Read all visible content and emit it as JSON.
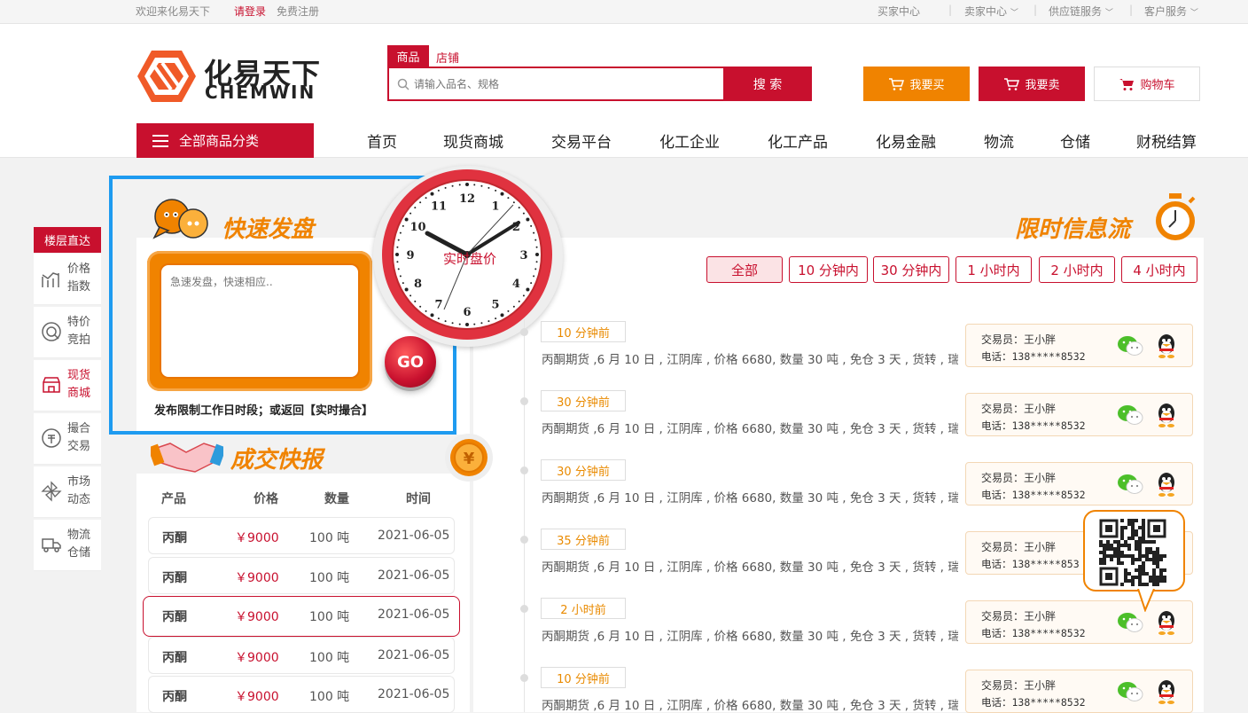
{
  "topbar": {
    "welcome": "欢迎来化易天下",
    "login": "请登录",
    "register": "免费注册",
    "links": [
      "买家中心",
      "卖家中心",
      "供应链服务",
      "客户服务"
    ]
  },
  "brand": {
    "name_cn": "化易天下",
    "name_en": "CHEMWIN"
  },
  "search": {
    "tabs": [
      "商品",
      "店铺"
    ],
    "placeholder": "请输入品名、规格",
    "button": "搜 索"
  },
  "header_buttons": {
    "buy": "我要买",
    "sell": "我要卖",
    "cart": "购物车"
  },
  "nav": {
    "all_categories": "全部商品分类",
    "items": [
      "首页",
      "现货商城",
      "交易平台",
      "化工企业",
      "化工产品",
      "化易金融",
      "物流",
      "仓储",
      "财税结算"
    ]
  },
  "sidebar": {
    "title": "楼层直达",
    "items": [
      "价格指数",
      "特价竞拍",
      "现货商城",
      "撮合交易",
      "市场动态",
      "物流仓储"
    ]
  },
  "quick_post": {
    "title": "快速发盘",
    "placeholder": "急速发盘，快速相应..",
    "go": "GO",
    "note": "发布限制工作日时段；或返回【实时撮合】"
  },
  "clock": {
    "label": "实时盘价",
    "numbers": [
      "12",
      "1",
      "2",
      "3",
      "4",
      "5",
      "6",
      "7",
      "8",
      "9",
      "10",
      "11"
    ]
  },
  "deals": {
    "title": "成交快报",
    "headers": [
      "产品",
      "价格",
      "数量",
      "时间"
    ],
    "rows": [
      [
        "丙酮",
        "￥9000",
        "100 吨",
        "2021-06-05"
      ],
      [
        "丙酮",
        "￥9000",
        "100 吨",
        "2021-06-05"
      ],
      [
        "丙酮",
        "￥9000",
        "100 吨",
        "2021-06-05"
      ],
      [
        "丙酮",
        "￥9000",
        "100 吨",
        "2021-06-05"
      ],
      [
        "丙酮",
        "￥9000",
        "100 吨",
        "2021-06-05"
      ]
    ]
  },
  "info_flow": {
    "title": "限时信息流",
    "filters": [
      "全部",
      "10 分钟内",
      "30 分钟内",
      "1 小时内",
      "2 小时内",
      "4 小时内"
    ],
    "items": [
      {
        "time": "10 分钟前",
        "text": "丙酮期货 ,6 月 10 日 , 江阴库 , 价格 6680, 数量 30 吨 , 免仓 3 天 , 货转 , 瑞桥",
        "trader": "交易员：王小胖",
        "phone": "电话：138*****8532"
      },
      {
        "time": "30 分钟前",
        "text": "丙酮期货 ,6 月 10 日 , 江阴库 , 价格 6680, 数量 30 吨 , 免仓 3 天 , 货转 , 瑞桥",
        "trader": "交易员：王小胖",
        "phone": "电话：138*****8532"
      },
      {
        "time": "30 分钟前",
        "text": "丙酮期货 ,6 月 10 日 , 江阴库 , 价格 6680, 数量 30 吨 , 免仓 3 天 , 货转 , 瑞桥",
        "trader": "交易员：王小胖",
        "phone": "电话：138*****8532"
      },
      {
        "time": "35 分钟前",
        "text": "丙酮期货 ,6 月 10 日 , 江阴库 , 价格 6680, 数量 30 吨 , 免仓 3 天 , 货转 , 瑞桥",
        "trader": "交易员：王小胖",
        "phone": "电话：138*****853"
      },
      {
        "time": "2 小时前",
        "text": "丙酮期货 ,6 月 10 日 , 江阴库 , 价格 6680, 数量 30 吨 , 免仓 3 天 , 货转 , 瑞桥",
        "trader": "交易员：王小胖",
        "phone": "电话：138*****8532"
      },
      {
        "time": "10 分钟前",
        "text": "丙酮期货 ,6 月 10 日 , 江阴库 , 价格 6680, 数量 30 吨 , 免仓 3 天 , 货转 , 瑞桥",
        "trader": "交易员：王小胖",
        "phone": "电话：138*****8532"
      }
    ]
  },
  "colors": {
    "brand_red": "#c8102e",
    "orange": "#f08300",
    "highlight_blue": "#1e9bf0"
  }
}
